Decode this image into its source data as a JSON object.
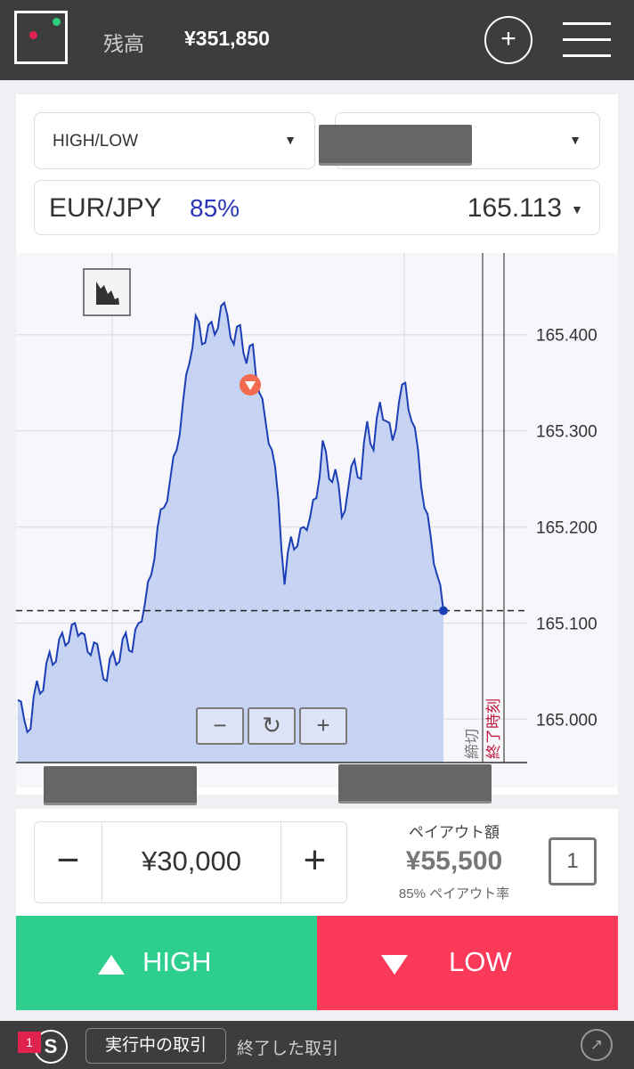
{
  "header": {
    "balance_label": "残高",
    "balance_value": "¥351,850",
    "add_label": "+"
  },
  "selectors": {
    "trade_type": "HIGH/LOW",
    "asset_pair": "EUR/JPY",
    "payout_pct": "85%",
    "rate": "165.113"
  },
  "chart_data": {
    "type": "area",
    "y_ticks": [
      "165.400",
      "165.300",
      "165.200",
      "165.100",
      "165.000"
    ],
    "ylim": [
      164.955,
      165.485
    ],
    "current_rate": 165.113,
    "deadline_label": "締切",
    "end_label": "終了時刻",
    "series": [
      {
        "values": [
          165.02,
          165.0,
          164.99,
          165.04,
          165.03,
          165.07,
          165.06,
          165.09,
          165.08,
          165.1,
          165.09,
          165.07,
          165.08,
          165.06,
          165.04,
          165.07,
          165.06,
          165.09,
          165.07,
          165.1,
          165.12,
          165.15,
          165.2,
          165.22,
          165.25,
          165.28,
          165.33,
          165.37,
          165.42,
          165.39,
          165.41,
          165.4,
          165.43,
          165.42,
          165.39,
          165.41,
          165.37,
          165.39,
          165.34,
          165.31,
          165.28,
          165.23,
          165.14,
          165.19,
          165.18,
          165.2,
          165.21,
          165.23,
          165.29,
          165.25,
          165.26,
          165.21,
          165.24,
          165.27,
          165.25,
          165.31,
          165.28,
          165.33,
          165.31,
          165.29,
          165.33,
          165.35,
          165.31,
          165.28,
          165.22,
          165.19,
          165.15,
          165.113
        ]
      }
    ]
  },
  "chart_controls": {
    "zoom_out": "−",
    "reset": "↻",
    "zoom_in": "+"
  },
  "amount": {
    "minus": "−",
    "value": "¥30,000",
    "plus": "+",
    "payout_label": "ペイアウト額",
    "payout_value": "¥55,500",
    "payout_rate": "85% ペイアウト率",
    "one_click": "1"
  },
  "actions": {
    "high": "HIGH",
    "low": "LOW"
  },
  "bottom": {
    "badge": "1",
    "icon_label": "S",
    "tab_active": "実行中の取引",
    "tab_inactive": "終了した取引",
    "external_icon": "↗"
  }
}
